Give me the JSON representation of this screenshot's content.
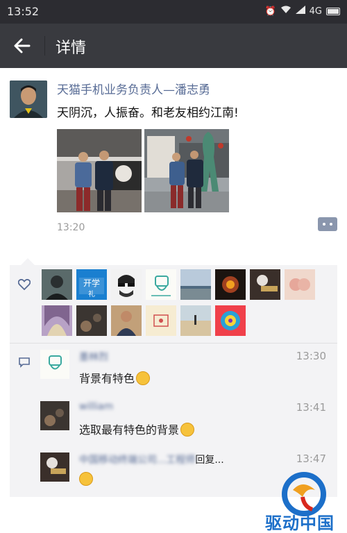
{
  "status": {
    "time": "13:52",
    "network": "4G"
  },
  "appbar": {
    "title": "详情",
    "back_icon": "arrow-left-icon"
  },
  "post": {
    "author": "天猫手机业务负责人—潘志勇",
    "text": "天阴沉，人振奋。和老友相约江南!",
    "time": "13:20"
  },
  "comments": [
    {
      "name": "墨林烈",
      "time": "13:30",
      "text": "背景有特色"
    },
    {
      "name": "william",
      "time": "13:41",
      "text": "选取最有特色的背景"
    },
    {
      "name": "中国移动终端公司...工程师",
      "reply": "回复...",
      "time": "13:47",
      "text": ""
    }
  ],
  "watermark": {
    "text": "驱动中国"
  },
  "colors": {
    "link": "#576b95",
    "appbar": "#393a3f",
    "statusbar": "#2c2c31",
    "panel": "#f3f3f5"
  }
}
